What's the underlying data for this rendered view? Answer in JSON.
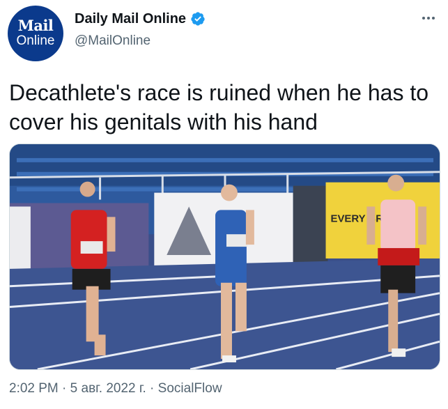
{
  "author": {
    "logo_line1": "Mail",
    "logo_line2": "Online",
    "display_name": "Daily Mail Online",
    "handle": "@MailOnline",
    "verified": true
  },
  "tweet": {
    "text": "Decathlete's race is ruined when he has to cover his genitals with his hand"
  },
  "media": {
    "banner_text": "EVERY BRIGHT"
  },
  "meta": {
    "time": "2:02 PM",
    "separator1": " · ",
    "date": "5 авг. 2022 г.",
    "separator2": " · ",
    "source": "SocialFlow"
  },
  "colors": {
    "brand_avatar": "#0b3a8c",
    "verified": "#1d9bf0",
    "secondary_text": "#536471",
    "track": "#3d5591",
    "lane_lines": "#e8ecf5"
  },
  "icons": {
    "verified": "verified-badge-icon",
    "more": "more-dots-icon"
  }
}
